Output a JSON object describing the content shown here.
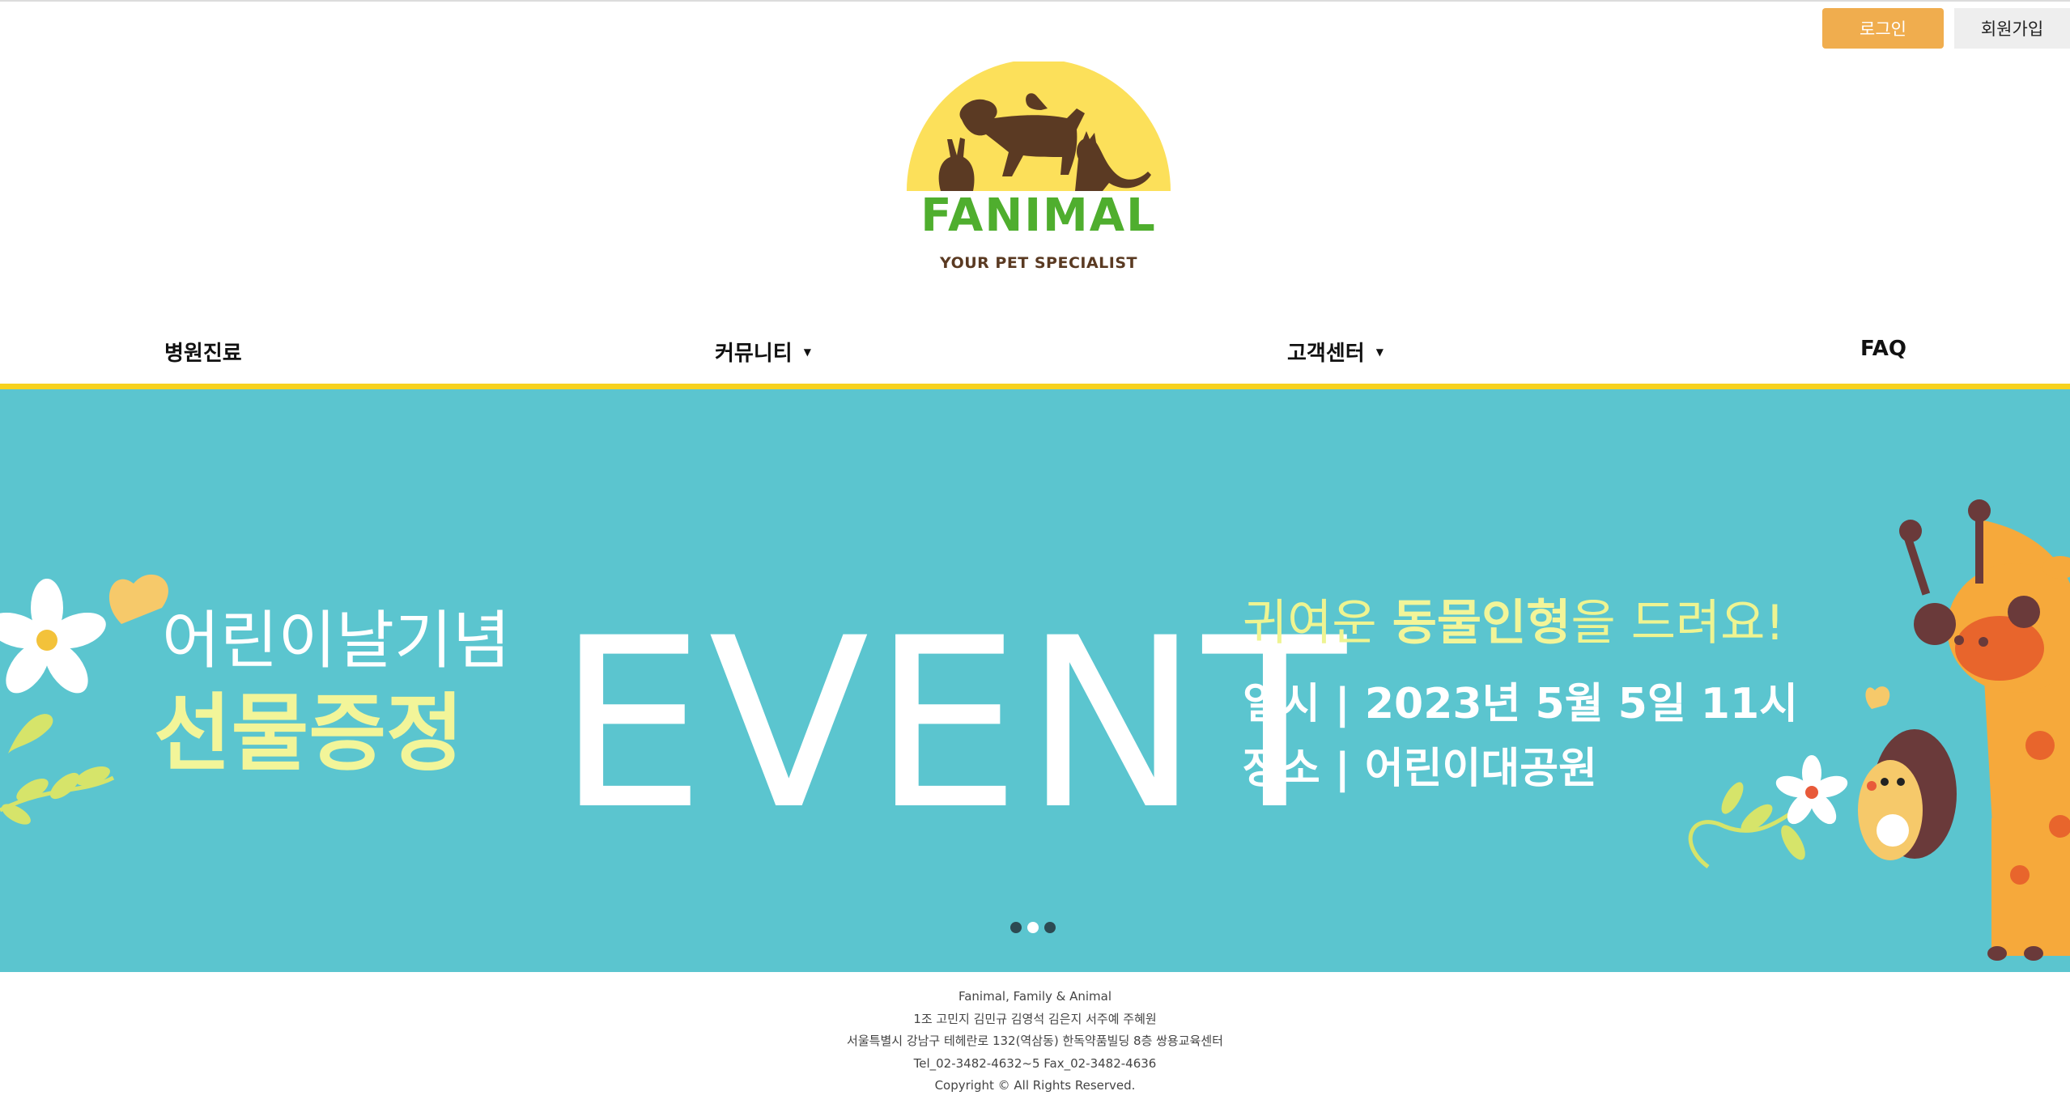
{
  "header": {
    "login_label": "로그인",
    "signup_label": "회원가입"
  },
  "logo": {
    "title": "FANIMAL",
    "subtitle": "YOUR PET SPECIALIST",
    "colors": {
      "sun": "#fce05a",
      "animals": "#5b3a23",
      "title": "#4fae2e"
    }
  },
  "nav": {
    "items": [
      {
        "label": "병원진료",
        "has_dropdown": false
      },
      {
        "label": "커뮤니티",
        "has_dropdown": true
      },
      {
        "label": "고객센터",
        "has_dropdown": true
      },
      {
        "label": "FAQ",
        "has_dropdown": false
      }
    ],
    "accent_color": "#f7d21e"
  },
  "banner": {
    "background": "#5bc5cf",
    "left_line1": "어린이날기념",
    "left_line2": "선물증정",
    "center": "EVENT",
    "right_line1_a": "귀여운 ",
    "right_line1_b": "동물인형",
    "right_line1_c": "을 드려요!",
    "right_line2": "일시 | 2023년 5월 5일 11시",
    "right_line3": "장소 | 어린이대공원",
    "slides": 3,
    "active_slide": 2
  },
  "footer": {
    "lines": [
      "Fanimal, Family & Animal",
      "1조 고민지 김민규 김영석 김은지 서주예 주혜원",
      "서울특별시 강남구 테헤란로 132(역삼동) 한독약품빌딩 8층 쌍용교육센터",
      "Tel_02-3482-4632~5 Fax_02-3482-4636",
      "Copyright © All Rights Reserved."
    ]
  }
}
